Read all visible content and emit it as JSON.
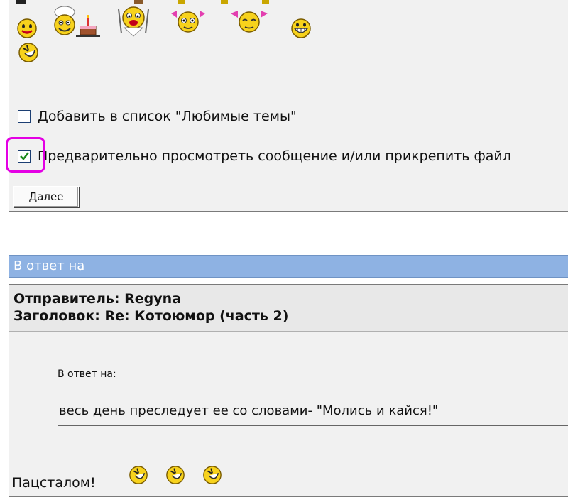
{
  "form": {
    "favorite_label": "Добавить в список \"Любимые темы\"",
    "favorite_checked": false,
    "preview_label": "Предварительно просмотреть сообщение и/или прикрепить файл",
    "preview_checked": true,
    "next_button": "Далее"
  },
  "reply": {
    "header": "В ответ на",
    "sender": "Отправитель: Regyna",
    "subject": "Заголовок: Re: Котоюмор (часть 2)",
    "quote_label": "В ответ на:",
    "quote_text": "весь день преследует ее со словами- \"Молись и кайся!\"",
    "footer_text": "Пацсталом!"
  },
  "colors": {
    "highlight": "#e400e4",
    "header_bg": "#8eb2e3",
    "panel_bg": "#f1f1f1"
  }
}
